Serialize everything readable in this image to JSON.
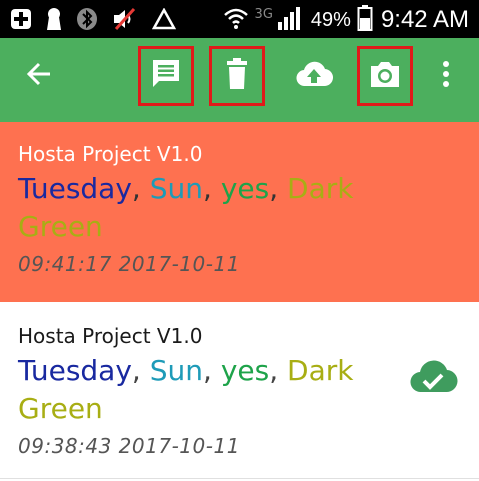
{
  "status_bar": {
    "network_type": "3G",
    "battery_percent": "49%",
    "time": "9:42 AM"
  },
  "app_bar": {
    "color": "#4caf5e",
    "actions": [
      "back-arrow-icon",
      "message-icon",
      "trash-icon",
      "cloud-upload-icon",
      "camera-icon",
      "more-vert-icon"
    ]
  },
  "records": [
    {
      "title": "Hosta Project V1.0",
      "day": "Tuesday",
      "weather": "Sun",
      "answer": "yes",
      "color": "Dark Green",
      "timestamp": "09:41:17 2017-10-11",
      "selected": true,
      "synced": false
    },
    {
      "title": "Hosta Project V1.0",
      "day": "Tuesday",
      "weather": "Sun",
      "answer": "yes",
      "color": "Dark Green",
      "timestamp": "09:38:43 2017-10-11",
      "selected": false,
      "synced": true
    }
  ],
  "colors": {
    "selected_row": "#fe7150",
    "highlight_outline": "#e01a1a",
    "sync_icon": "#3f9c5e"
  }
}
